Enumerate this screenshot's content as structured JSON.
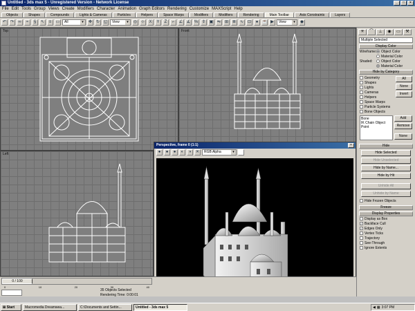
{
  "window": {
    "title": "Untitled - 3ds max 5 - Unregistered Version - Network License"
  },
  "menu": [
    "File",
    "Edit",
    "Tools",
    "Group",
    "Views",
    "Create",
    "Modifiers",
    "Character",
    "Animation",
    "Graph Editors",
    "Rendering",
    "Customize",
    "MAXScript",
    "Help"
  ],
  "tabs": [
    {
      "label": "Objects",
      "active": false
    },
    {
      "label": "Shapes",
      "active": false
    },
    {
      "label": "Compounds",
      "active": false
    },
    {
      "label": "Lights & Cameras",
      "active": false
    },
    {
      "label": "Particles",
      "active": false
    },
    {
      "label": "Helpers",
      "active": false
    },
    {
      "label": "Space Warps",
      "active": false
    },
    {
      "label": "Modifiers",
      "active": false
    },
    {
      "label": "Modifiers",
      "active": false
    },
    {
      "label": "Rendering",
      "active": false
    },
    {
      "label": "Main Toolbar",
      "active": true
    },
    {
      "label": "Axis Constraints",
      "active": false
    },
    {
      "label": "Layers",
      "active": false
    }
  ],
  "toolbar": {
    "filter_select": "All",
    "view_select": "View",
    "view_select2": "View"
  },
  "viewports": {
    "top": "Top",
    "front": "Front",
    "left": "Left",
    "perspective": "Perspective"
  },
  "panel": {
    "selection_field": "Multiple Selected",
    "display_color": {
      "title": "Display Color",
      "wireframe_label": "Wireframe:",
      "shaded_label": "Shaded:",
      "object_color": "Object Color",
      "material_color": "Material Color"
    },
    "hide_by_category": {
      "title": "Hide by Category",
      "items": [
        "Geometry",
        "Shapes",
        "Lights",
        "Cameras",
        "Helpers",
        "Space Warps",
        "Particle Systems",
        "Bone Objects"
      ],
      "all_btn": "All",
      "none_btn": "None",
      "invert_btn": "Invert",
      "list_items": [
        "Bone",
        "IK Chain Object",
        "Point"
      ],
      "add_btn": "Add",
      "remove_btn": "Remove",
      "none2_btn": "None"
    },
    "hide": {
      "title": "Hide",
      "buttons": [
        "Hide Selected",
        "Hide Unselected",
        "Hide by Name...",
        "Hide by Hit",
        "Unhide All",
        "Unhide by Name"
      ],
      "frozen_label": "Hide Frozen Objects"
    },
    "freeze": {
      "title": "Freeze"
    },
    "display_properties": {
      "title": "Display Properties",
      "items": [
        {
          "label": "Display as Box",
          "checked": false
        },
        {
          "label": "Backface Cull",
          "checked": true
        },
        {
          "label": "Edges Only",
          "checked": true
        },
        {
          "label": "Vertex Ticks",
          "checked": false
        },
        {
          "label": "Trajectory",
          "checked": false
        },
        {
          "label": "See-Through",
          "checked": false
        },
        {
          "label": "Ignore Extents",
          "checked": false
        }
      ]
    }
  },
  "render_window": {
    "title": "Perspective, frame 0 (1:1)",
    "channel_select": "RGB Alpha"
  },
  "timeline": {
    "counter": "0 / 100",
    "ticks": [
      "0",
      "10",
      "20",
      "30",
      "40"
    ]
  },
  "status": {
    "selected": "35 Objects Selected",
    "rendering_time": "Rendering Time: 0:00:01"
  },
  "taskbar": {
    "start": "Start",
    "tasks": [
      {
        "label": "Macromedia Dreamwea...",
        "active": false
      },
      {
        "label": "C:\\Documents and Settin...",
        "active": false
      },
      {
        "label": "Untitled - 3ds max 5",
        "active": true
      }
    ],
    "clock": "3:07 PM"
  },
  "colors": {
    "titlebar": "#0a246a",
    "viewport_bg": "#7f7f7f",
    "render_bg": "#000000"
  }
}
